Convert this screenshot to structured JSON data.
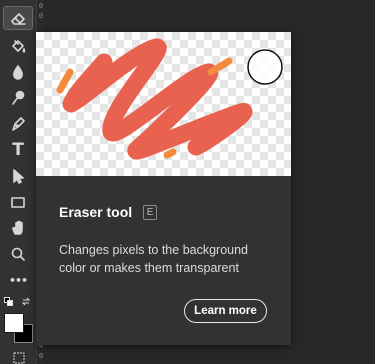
{
  "toolbar": {
    "tools": [
      {
        "name": "eraser-tool",
        "icon": "eraser-icon",
        "active": true
      },
      {
        "name": "paint-bucket-tool",
        "icon": "paint-bucket-icon"
      },
      {
        "name": "blur-tool",
        "icon": "droplet-icon"
      },
      {
        "name": "dodge-tool",
        "icon": "dodge-icon"
      },
      {
        "name": "pen-tool",
        "icon": "pen-icon"
      },
      {
        "name": "type-tool",
        "icon": "type-icon",
        "glyph": "T"
      },
      {
        "name": "path-selection-tool",
        "icon": "arrow-icon"
      },
      {
        "name": "rectangle-tool",
        "icon": "rectangle-icon"
      },
      {
        "name": "hand-tool",
        "icon": "hand-icon"
      },
      {
        "name": "zoom-tool",
        "icon": "zoom-icon"
      },
      {
        "name": "more-tools",
        "icon": "more-icon",
        "glyph": "•••"
      }
    ],
    "foreground_color": "#ffffff",
    "background_color": "#000000"
  },
  "ruler": {
    "labels": [
      "0",
      "0",
      "4",
      "0"
    ]
  },
  "tooltip": {
    "title": "Eraser tool",
    "shortcut": "E",
    "description": "Changes pixels to the background color or makes them transparent",
    "learn_more": "Learn more",
    "stroke_color": "#e8624f",
    "accent_color": "#f28c3c"
  }
}
